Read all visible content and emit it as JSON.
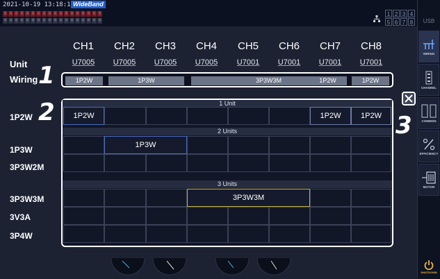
{
  "status": {
    "datetime": "2021-10-19 13:18:16",
    "mode": "WideBand",
    "page_numbers": [
      "1",
      "2",
      "3",
      "4",
      "5",
      "6",
      "7",
      "8"
    ],
    "usb_label": "USB"
  },
  "header": {
    "channels": [
      "CH1",
      "CH2",
      "CH3",
      "CH4",
      "CH5",
      "CH6",
      "CH7",
      "CH8"
    ],
    "unit_label": "Unit",
    "units": [
      "U7005",
      "U7005",
      "U7005",
      "U7005",
      "U7001",
      "U7001",
      "U7001",
      "U7001"
    ],
    "wiring_label": "Wiring",
    "wiring_segments": [
      "1P2W",
      "1P3W",
      "3P3W3M",
      "1P2W",
      "1P2W"
    ]
  },
  "callouts": [
    "1",
    "2",
    "3"
  ],
  "panel": {
    "sections": [
      "1 Unit",
      "2 Units",
      "3 Units"
    ],
    "row_labels": [
      "1P2W",
      "1P3W",
      "3P3W2M",
      "3P3W3M",
      "3V3A",
      "3P4W"
    ],
    "options": {
      "one_unit_a": "1P2W",
      "one_unit_b": "1P2W",
      "one_unit_c": "1P2W",
      "two_units": "1P3W",
      "three_units": "3P3W3M"
    }
  },
  "sidebar": {
    "wiring": "WIRING",
    "channel": "CHANNEL",
    "common": "COMMON",
    "efficiency": "EFFICIENCY",
    "motor": "MOTOR",
    "shutdown": "SHUTDOWN"
  },
  "colors": {
    "background": "#1c2232",
    "panel_border": "#ffffff",
    "selected_blue": "#4a6bc2",
    "selected_yellow": "#c4b23a",
    "wiring_segment": "#6c7488",
    "wideband": "#1f5fd1"
  }
}
